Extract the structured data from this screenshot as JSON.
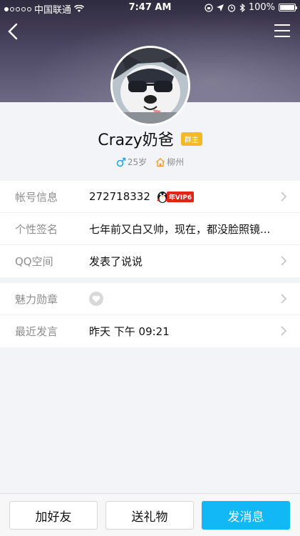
{
  "status_bar": {
    "carrier": "中国联通",
    "time": "7:47 AM",
    "battery": "100%"
  },
  "profile": {
    "name": "Crazy奶爸",
    "role_badge": "群主",
    "age": "25岁",
    "location": "柳州"
  },
  "info": {
    "account_label": "帐号信息",
    "account_value": "272718332",
    "vip_text": "年VIP6",
    "signature_label": "个性签名",
    "signature_value": "七年前又白又帅，现在，都没脸照镜...",
    "qzone_label": "QQ空间",
    "qzone_value": "发表了说说",
    "medal_label": "魅力勋章",
    "recent_label": "最近发言",
    "recent_value": "昨天 下午 09:21"
  },
  "actions": {
    "add_friend": "加好友",
    "send_gift": "送礼物",
    "send_message": "发消息"
  },
  "colors": {
    "accent": "#12b7f5",
    "badge": "#f6b827",
    "vip": "#e2231a"
  }
}
